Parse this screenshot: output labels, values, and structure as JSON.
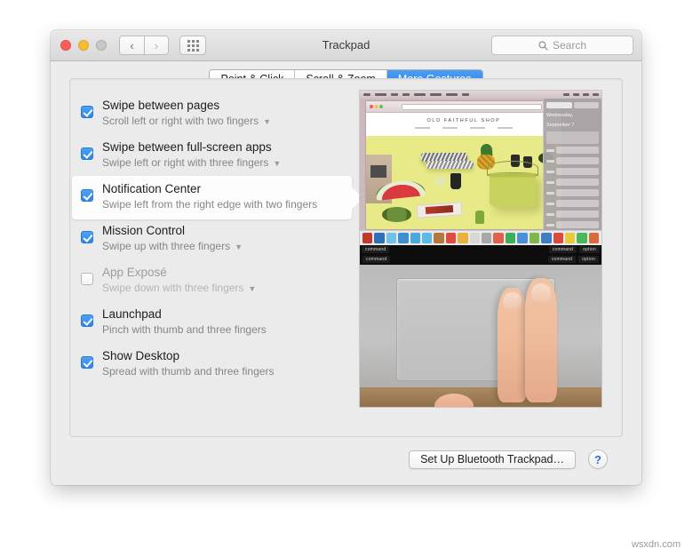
{
  "window": {
    "title": "Trackpad",
    "traffic_lights": [
      "close",
      "minimize",
      "zoom"
    ],
    "nav_back": "‹",
    "nav_forward": "›",
    "show_all_icon": "grid-icon",
    "search": {
      "placeholder": "Search",
      "icon": "search-icon"
    }
  },
  "tabs": [
    {
      "label": "Point & Click",
      "active": false
    },
    {
      "label": "Scroll & Zoom",
      "active": false
    },
    {
      "label": "More Gestures",
      "active": true
    }
  ],
  "gestures": [
    {
      "title": "Swipe between pages",
      "description": "Scroll left or right with two fingers",
      "checked": true,
      "enabled": true,
      "has_dropdown": true,
      "selected": false
    },
    {
      "title": "Swipe between full-screen apps",
      "description": "Swipe left or right with three fingers",
      "checked": true,
      "enabled": true,
      "has_dropdown": true,
      "selected": false
    },
    {
      "title": "Notification Center",
      "description": "Swipe left from the right edge with two fingers",
      "checked": true,
      "enabled": true,
      "has_dropdown": false,
      "selected": true
    },
    {
      "title": "Mission Control",
      "description": "Swipe up with three fingers",
      "checked": true,
      "enabled": true,
      "has_dropdown": true,
      "selected": false
    },
    {
      "title": "App Exposé",
      "description": "Swipe down with three fingers",
      "checked": false,
      "enabled": false,
      "has_dropdown": true,
      "selected": false
    },
    {
      "title": "Launchpad",
      "description": "Pinch with thumb and three fingers",
      "checked": true,
      "enabled": true,
      "has_dropdown": false,
      "selected": false
    },
    {
      "title": "Show Desktop",
      "description": "Spread with thumb and three fingers",
      "checked": true,
      "enabled": true,
      "has_dropdown": false,
      "selected": false
    }
  ],
  "preview": {
    "name": "gesture-demo-preview",
    "top_scene": "macos-desktop-with-notification-center",
    "bottom_scene": "two-fingers-on-trackpad",
    "browser_shop_title": "OLD FAITHFUL SHOP",
    "notification_date_line1": "Wednesday,",
    "notification_date_line2": "September 7",
    "keys": [
      "command",
      "command",
      "option"
    ]
  },
  "footer": {
    "setup_button": "Set Up Bluetooth Trackpad…",
    "help_button": "?"
  },
  "watermark": "wsxdn.com",
  "colors": {
    "accent_blue": "#2a7fe8",
    "checkbox_blue": "#2b86ec",
    "window_bg": "#ececec",
    "panel_bg": "#ebebeb",
    "help_blue": "#2e6fc4"
  }
}
